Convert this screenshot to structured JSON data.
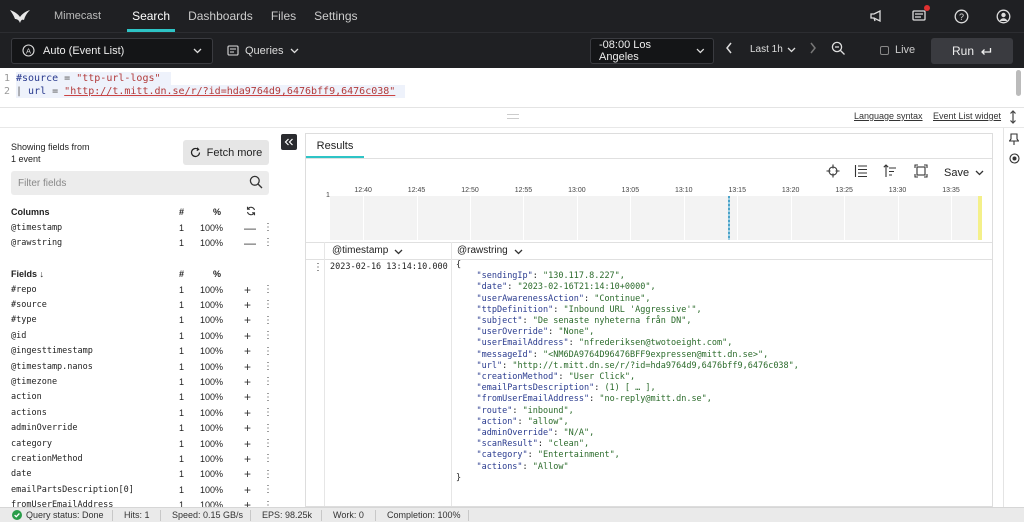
{
  "nav": {
    "org": "Mimecast",
    "tabs": [
      {
        "label": "Search",
        "active": true
      },
      {
        "label": "Dashboards",
        "active": false
      },
      {
        "label": "Files",
        "active": false
      },
      {
        "label": "Settings",
        "active": false
      }
    ],
    "icons": [
      "megaphone-icon",
      "notifications-icon",
      "help-icon",
      "user-icon"
    ],
    "accent": "#2ec4c6"
  },
  "toolbar": {
    "repo": "Auto (Event List)",
    "queries": "Queries",
    "timezone": "-08:00 Los Angeles",
    "range": "Last 1h",
    "live": "Live",
    "run": "Run"
  },
  "editor": {
    "lines": [
      {
        "num": "1",
        "keyword": "#source",
        "op": " = ",
        "value": "\"ttp-url-logs\""
      },
      {
        "num": "2",
        "prefix": "| ",
        "keyword": "url",
        "op": " = ",
        "value": "\"http://t.mitt.dn.se/r/?id=hda9764d9,6476bff9,6476c038\""
      }
    ],
    "links": {
      "syntax": "Language syntax",
      "widget": "Event List widget"
    }
  },
  "fields_panel": {
    "showing_line1": "Showing fields from",
    "showing_line2": "1 event",
    "fetch_more": "Fetch more",
    "filter_placeholder": "Filter fields",
    "columns_header": {
      "title": "Columns",
      "count": "#",
      "pct": "%"
    },
    "columns": [
      {
        "name": "@timestamp",
        "count": "1",
        "pct": "100%",
        "action": "—"
      },
      {
        "name": "@rawstring",
        "count": "1",
        "pct": "100%",
        "action": "—"
      }
    ],
    "fields_header": {
      "title": "Fields ↓",
      "count": "#",
      "pct": "%"
    },
    "fields": [
      {
        "name": "#repo",
        "count": "1",
        "pct": "100%"
      },
      {
        "name": "#source",
        "count": "1",
        "pct": "100%"
      },
      {
        "name": "#type",
        "count": "1",
        "pct": "100%"
      },
      {
        "name": "@id",
        "count": "1",
        "pct": "100%"
      },
      {
        "name": "@ingesttimestamp",
        "count": "1",
        "pct": "100%"
      },
      {
        "name": "@timestamp.nanos",
        "count": "1",
        "pct": "100%"
      },
      {
        "name": "@timezone",
        "count": "1",
        "pct": "100%"
      },
      {
        "name": "action",
        "count": "1",
        "pct": "100%"
      },
      {
        "name": "actions",
        "count": "1",
        "pct": "100%"
      },
      {
        "name": "adminOverride",
        "count": "1",
        "pct": "100%"
      },
      {
        "name": "category",
        "count": "1",
        "pct": "100%"
      },
      {
        "name": "creationMethod",
        "count": "1",
        "pct": "100%"
      },
      {
        "name": "date",
        "count": "1",
        "pct": "100%"
      },
      {
        "name": "emailPartsDescription[0]",
        "count": "1",
        "pct": "100%"
      },
      {
        "name": "fromUserEmailAddress",
        "count": "1",
        "pct": "100%"
      }
    ]
  },
  "results": {
    "tab": "Results",
    "save": "Save",
    "timeline": {
      "y_label": "1",
      "ticks": [
        "12:40",
        "12:45",
        "12:50",
        "12:55",
        "13:00",
        "13:05",
        "13:10",
        "13:15",
        "13:20",
        "13:25",
        "13:30",
        "13:35"
      ],
      "event_time": "13:14",
      "event_count": 1
    },
    "columns": [
      "@timestamp",
      "@rawstring"
    ],
    "row": {
      "timestamp": "2023-02-16 13:14:10.000",
      "open": "{",
      "close": "}",
      "fields": [
        {
          "k": "\"sendingIp\"",
          "v": "\"130.117.8.227\","
        },
        {
          "k": "\"date\"",
          "v": "\"2023-02-16T21:14:10+0000\","
        },
        {
          "k": "\"userAwarenessAction\"",
          "v": "\"Continue\","
        },
        {
          "k": "\"ttpDefinition\"",
          "v": "\"Inbound URL 'Aggressive'\","
        },
        {
          "k": "\"subject\"",
          "v": "\"De senaste nyheterna från DN\","
        },
        {
          "k": "\"userOverride\"",
          "v": "\"None\","
        },
        {
          "k": "\"userEmailAddress\"",
          "v": "\"nfrederiksen@twotoeight.com\","
        },
        {
          "k": "\"messageId\"",
          "v": "\"<NM6DA9764D96476BFF9expressen@mitt.dn.se>\","
        },
        {
          "k": "\"url\"",
          "v": "\"http://t.mitt.dn.se/r/?id=hda9764d9,6476bff9,6476c038\","
        },
        {
          "k": "\"creationMethod\"",
          "v": "\"User Click\","
        },
        {
          "k": "\"emailPartsDescription\"",
          "v": "(1) [ … ],"
        },
        {
          "k": "\"fromUserEmailAddress\"",
          "v": "\"no-reply@mitt.dn.se\","
        },
        {
          "k": "\"route\"",
          "v": "\"inbound\","
        },
        {
          "k": "\"action\"",
          "v": "\"allow\","
        },
        {
          "k": "\"adminOverride\"",
          "v": "\"N/A\","
        },
        {
          "k": "\"scanResult\"",
          "v": "\"clean\","
        },
        {
          "k": "\"category\"",
          "v": "\"Entertainment\","
        },
        {
          "k": "\"actions\"",
          "v": "\"Allow\""
        }
      ]
    }
  },
  "status": {
    "query_status": "Query status: Done",
    "hits": "Hits: 1",
    "speed": "Speed: 0.15 GB/s",
    "eps": "EPS: 98.25k",
    "work": "Work: 0",
    "completion": "Completion: 100%",
    "ok_color": "#2a9d4a"
  }
}
